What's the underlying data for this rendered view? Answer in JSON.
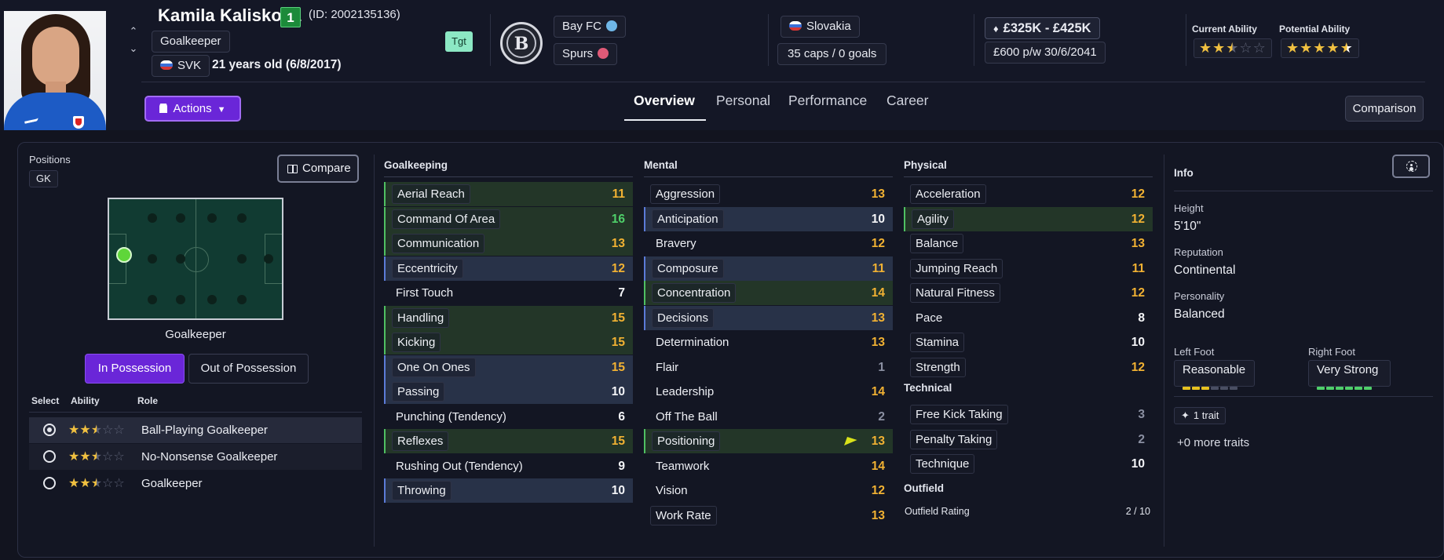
{
  "player": {
    "name": "Kamila Kalisková",
    "squad_number": "1",
    "id_text": "(ID: 2002135136)",
    "position": "Goalkeeper",
    "nation_code": "SVK",
    "age_text": "21 years old (6/8/2017)",
    "target_badge": "Tgt"
  },
  "clubs": {
    "badge_letter": "B",
    "primary": "Bay FC",
    "secondary": "Spurs"
  },
  "international": {
    "country": "Slovakia",
    "caps": "35 caps / 0 goals"
  },
  "contract": {
    "value": "£325K - £425K",
    "wage": "£600 p/w 30/6/2041"
  },
  "ability": {
    "current_label": "Current Ability",
    "potential_label": "Potential Ability",
    "current_stars": 2.5,
    "potential_stars": 4.5
  },
  "actions": {
    "label": "Actions"
  },
  "tabs": [
    "Overview",
    "Personal",
    "Performance",
    "Career"
  ],
  "active_tab": "Overview",
  "comparison_label": "Comparison",
  "positions_panel": {
    "label": "Positions",
    "code": "GK",
    "compare_label": "Compare",
    "pitch_label": "Goalkeeper",
    "in_possession": "In Possession",
    "out_possession": "Out of Possession",
    "headers": {
      "select": "Select",
      "ability": "Ability",
      "role": "Role"
    },
    "roles": [
      {
        "name": "Ball-Playing Goalkeeper",
        "stars": 2.5,
        "selected": true
      },
      {
        "name": "No-Nonsense Goalkeeper",
        "stars": 2.5,
        "selected": false
      },
      {
        "name": "Goalkeeper",
        "stars": 2.5,
        "selected": false
      }
    ]
  },
  "attributes": {
    "goalkeeping": {
      "title": "Goalkeeping",
      "items": [
        {
          "name": "Aerial Reach",
          "value": "11",
          "hl": "green",
          "color": "yellow"
        },
        {
          "name": "Command Of Area",
          "value": "16",
          "hl": "green",
          "color": "green"
        },
        {
          "name": "Communication",
          "value": "13",
          "hl": "green",
          "color": "yellow"
        },
        {
          "name": "Eccentricity",
          "value": "12",
          "hl": "blue",
          "color": "yellow"
        },
        {
          "name": "First Touch",
          "value": "7",
          "hl": "",
          "color": "white"
        },
        {
          "name": "Handling",
          "value": "15",
          "hl": "green",
          "color": "yellow"
        },
        {
          "name": "Kicking",
          "value": "15",
          "hl": "green",
          "color": "yellow"
        },
        {
          "name": "One On Ones",
          "value": "15",
          "hl": "blue",
          "color": "yellow"
        },
        {
          "name": "Passing",
          "value": "10",
          "hl": "blue",
          "color": "white"
        },
        {
          "name": "Punching (Tendency)",
          "value": "6",
          "hl": "",
          "color": "white"
        },
        {
          "name": "Reflexes",
          "value": "15",
          "hl": "green",
          "color": "yellow"
        },
        {
          "name": "Rushing Out (Tendency)",
          "value": "9",
          "hl": "",
          "color": "white"
        },
        {
          "name": "Throwing",
          "value": "10",
          "hl": "blue",
          "color": "white"
        }
      ]
    },
    "mental": {
      "title": "Mental",
      "items": [
        {
          "name": "Aggression",
          "value": "13",
          "hl": "",
          "color": "yellow"
        },
        {
          "name": "Anticipation",
          "value": "10",
          "hl": "blue",
          "color": "white"
        },
        {
          "name": "Bravery",
          "value": "12",
          "hl": "",
          "color": "yellow"
        },
        {
          "name": "Composure",
          "value": "11",
          "hl": "blue",
          "color": "yellow"
        },
        {
          "name": "Concentration",
          "value": "14",
          "hl": "green",
          "color": "yellow"
        },
        {
          "name": "Decisions",
          "value": "13",
          "hl": "blue",
          "color": "yellow"
        },
        {
          "name": "Determination",
          "value": "13",
          "hl": "",
          "color": "yellow"
        },
        {
          "name": "Flair",
          "value": "1",
          "hl": "",
          "color": "grey"
        },
        {
          "name": "Leadership",
          "value": "14",
          "hl": "",
          "color": "yellow"
        },
        {
          "name": "Off The Ball",
          "value": "2",
          "hl": "",
          "color": "grey"
        },
        {
          "name": "Positioning",
          "value": "13",
          "hl": "green",
          "color": "yellow"
        },
        {
          "name": "Teamwork",
          "value": "14",
          "hl": "",
          "color": "yellow"
        },
        {
          "name": "Vision",
          "value": "12",
          "hl": "",
          "color": "yellow"
        },
        {
          "name": "Work Rate",
          "value": "13",
          "hl": "",
          "color": "yellow"
        }
      ]
    },
    "physical": {
      "title": "Physical",
      "items": [
        {
          "name": "Acceleration",
          "value": "12",
          "hl": "",
          "color": "yellow"
        },
        {
          "name": "Agility",
          "value": "12",
          "hl": "green",
          "color": "yellow"
        },
        {
          "name": "Balance",
          "value": "13",
          "hl": "",
          "color": "yellow"
        },
        {
          "name": "Jumping Reach",
          "value": "11",
          "hl": "",
          "color": "yellow"
        },
        {
          "name": "Natural Fitness",
          "value": "12",
          "hl": "",
          "color": "yellow"
        },
        {
          "name": "Pace",
          "value": "8",
          "hl": "",
          "color": "white"
        },
        {
          "name": "Stamina",
          "value": "10",
          "hl": "",
          "color": "white"
        },
        {
          "name": "Strength",
          "value": "12",
          "hl": "",
          "color": "yellow"
        }
      ]
    },
    "technical": {
      "title": "Technical",
      "items": [
        {
          "name": "Free Kick Taking",
          "value": "3",
          "hl": "",
          "color": "grey"
        },
        {
          "name": "Penalty Taking",
          "value": "2",
          "hl": "",
          "color": "grey"
        },
        {
          "name": "Technique",
          "value": "10",
          "hl": "",
          "color": "white"
        }
      ]
    },
    "outfield": {
      "title": "Outfield",
      "rating_label": "Outfield Rating",
      "rating_value": "2 / 10"
    }
  },
  "info": {
    "title": "Info",
    "height_label": "Height",
    "height": "5'10\"",
    "reputation_label": "Reputation",
    "reputation": "Continental",
    "personality_label": "Personality",
    "personality": "Balanced",
    "left_foot_label": "Left Foot",
    "left_foot": "Reasonable",
    "left_foot_level": 3,
    "right_foot_label": "Right Foot",
    "right_foot": "Very Strong",
    "right_foot_level": 6,
    "traits": "1 trait",
    "more_traits": "+0 more traits"
  },
  "colors": {
    "accent": "#6a26d8",
    "attr_yellow": "#f2b233",
    "attr_green": "#4fd06a",
    "highlight_green": "#233628",
    "highlight_blue": "#283248"
  }
}
